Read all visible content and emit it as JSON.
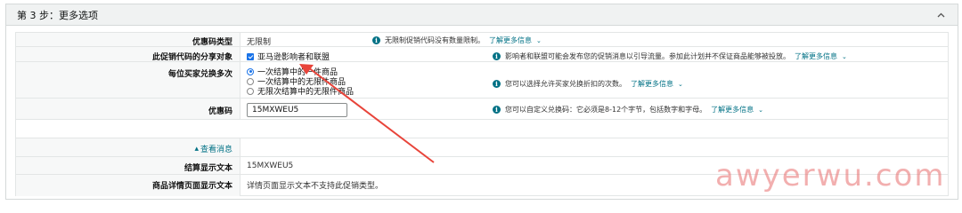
{
  "step": {
    "title": "第 3 步：更多选项",
    "collapse_icon": "chevron-up-icon"
  },
  "rows": {
    "coupon_type": {
      "label": "优惠码类型",
      "value": "无限制",
      "help_text": "无限制促销代码没有数量限制。",
      "learn_more": "了解更多信息"
    },
    "share_target": {
      "label": "此促销代码的分享对象",
      "checkbox_label": "亚马逊影响者和联盟",
      "checked": true,
      "help_text": "影响者和联盟可能会发布您的促销消息以引导流量。参加此计划并不保证商品能够被投放。",
      "learn_more": "了解更多信息"
    },
    "redeem_limit": {
      "label": "每位买家兑换多次",
      "options": [
        "一次结算中的一件商品",
        "一次结算中的无限件商品",
        "无限次结算中的无限件商品"
      ],
      "selected": 0,
      "help_text": "您可以选择允许买家兑换折扣的次数。",
      "learn_more": "了解更多信息"
    },
    "coupon_code": {
      "label": "优惠码",
      "value": "15MXWEU5",
      "help_text": "您可以自定义兑换码：它必须是8-12个字节，包括数字和字母。",
      "learn_more": "了解更多信息"
    },
    "show_less": {
      "label": "查看消息",
      "icon": "caret-up-icon"
    },
    "checkout_text": {
      "label": "结算显示文本",
      "value": "15MXWEU5"
    },
    "detail_page_text": {
      "label": "商品详情页面显示文本",
      "value": "详情页面显示文本不支持此促销类型。"
    }
  },
  "annotation": {
    "arrow_color": "#e8443a"
  },
  "watermark": "awyerwu.com",
  "colors": {
    "link": "#007185",
    "info_icon": "#007185",
    "accent": "#1a73e8"
  }
}
